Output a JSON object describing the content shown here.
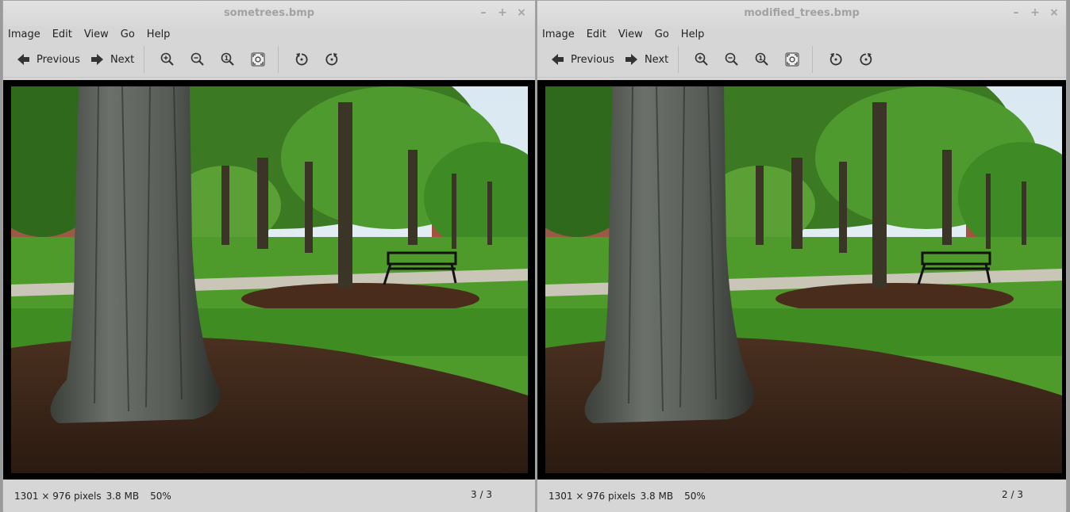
{
  "windows": [
    {
      "title": "sometrees.bmp",
      "menu": [
        "Image",
        "Edit",
        "View",
        "Go",
        "Help"
      ],
      "toolbar": {
        "previous": "Previous",
        "next": "Next"
      },
      "status": {
        "dimensions": "1301 × 976 pixels",
        "size": "3.8 MB",
        "zoom": "50%",
        "position": "3 / 3"
      }
    },
    {
      "title": "modified_trees.bmp",
      "menu": [
        "Image",
        "Edit",
        "View",
        "Go",
        "Help"
      ],
      "toolbar": {
        "previous": "Previous",
        "next": "Next"
      },
      "status": {
        "dimensions": "1301 × 976 pixels",
        "size": "3.8 MB",
        "zoom": "50%",
        "position": "2 / 3"
      }
    }
  ],
  "window_controls": [
    "–",
    "+",
    "×"
  ],
  "icons": [
    "arrow-left-icon",
    "arrow-right-icon",
    "zoom-in-icon",
    "zoom-out-icon",
    "zoom-original-icon",
    "zoom-fit-icon",
    "rotate-left-icon",
    "rotate-right-icon"
  ]
}
